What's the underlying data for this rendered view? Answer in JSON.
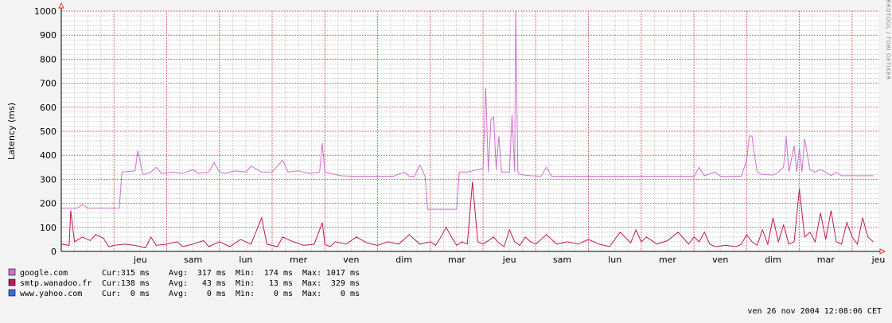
{
  "chart_data": {
    "type": "line",
    "ylabel": "Latency (ms)",
    "ylim": [
      0,
      1000
    ],
    "y_ticks": [
      0,
      100,
      200,
      300,
      400,
      500,
      600,
      700,
      800,
      900,
      1000
    ],
    "x_tick_labels": [
      "jeu",
      "sam",
      "lun",
      "mer",
      "ven",
      "dim",
      "mar",
      "jeu",
      "sam",
      "lun",
      "mer",
      "ven",
      "dim",
      "mar",
      "jeu"
    ],
    "x_units": "days",
    "x_range_days": [
      0,
      15.5
    ],
    "x_tick_days": [
      1,
      2,
      3,
      4,
      5,
      6,
      7,
      8,
      9,
      10,
      11,
      12,
      13,
      14,
      15
    ],
    "side_label": "RRDTOOL / TOBI OETIKER",
    "timestamp": "ven 26 nov 2004 12:08:06 CET",
    "grid": true,
    "colors": {
      "background": "#f3f3f3",
      "canvas": "#ffffff",
      "minor_grid": "#c8c8c8",
      "major_grid": "#d34a4a",
      "axis_arrow": "#e23a3a"
    },
    "series": [
      {
        "name": "google.com",
        "color": "#d070d0",
        "stats": {
          "cur": "315 ms",
          "avg": "317 ms",
          "min": "174 ms",
          "max": "1017 ms"
        },
        "points": [
          [
            0.0,
            180
          ],
          [
            0.3,
            180
          ],
          [
            0.4,
            195
          ],
          [
            0.5,
            180
          ],
          [
            0.8,
            180
          ],
          [
            1.1,
            180
          ],
          [
            1.15,
            330
          ],
          [
            1.4,
            335
          ],
          [
            1.45,
            420
          ],
          [
            1.55,
            320
          ],
          [
            1.7,
            330
          ],
          [
            1.8,
            350
          ],
          [
            1.9,
            325
          ],
          [
            2.1,
            330
          ],
          [
            2.3,
            325
          ],
          [
            2.5,
            340
          ],
          [
            2.6,
            325
          ],
          [
            2.8,
            330
          ],
          [
            2.9,
            370
          ],
          [
            3.0,
            330
          ],
          [
            3.1,
            325
          ],
          [
            3.3,
            335
          ],
          [
            3.5,
            330
          ],
          [
            3.6,
            355
          ],
          [
            3.8,
            330
          ],
          [
            4.0,
            330
          ],
          [
            4.2,
            380
          ],
          [
            4.3,
            330
          ],
          [
            4.5,
            335
          ],
          [
            4.7,
            325
          ],
          [
            4.9,
            330
          ],
          [
            4.95,
            450
          ],
          [
            5.0,
            330
          ],
          [
            5.2,
            320
          ],
          [
            5.3,
            315
          ],
          [
            5.5,
            313
          ],
          [
            5.7,
            313
          ],
          [
            6.0,
            313
          ],
          [
            6.3,
            313
          ],
          [
            6.5,
            330
          ],
          [
            6.6,
            313
          ],
          [
            6.7,
            313
          ],
          [
            6.8,
            360
          ],
          [
            6.9,
            313
          ],
          [
            6.95,
            175
          ],
          [
            7.2,
            175
          ],
          [
            7.5,
            175
          ],
          [
            7.55,
            330
          ],
          [
            7.7,
            330
          ],
          [
            7.9,
            340
          ],
          [
            8.0,
            345
          ],
          [
            8.05,
            680
          ],
          [
            8.1,
            330
          ],
          [
            8.15,
            550
          ],
          [
            8.2,
            560
          ],
          [
            8.25,
            340
          ],
          [
            8.3,
            480
          ],
          [
            8.35,
            330
          ],
          [
            8.5,
            330
          ],
          [
            8.55,
            570
          ],
          [
            8.6,
            330
          ],
          [
            8.62,
            1000
          ],
          [
            8.66,
            330
          ],
          [
            8.7,
            320
          ],
          [
            8.9,
            315
          ],
          [
            9.1,
            313
          ],
          [
            9.2,
            350
          ],
          [
            9.3,
            313
          ],
          [
            9.5,
            313
          ],
          [
            9.8,
            313
          ],
          [
            10.0,
            313
          ],
          [
            10.5,
            313
          ],
          [
            11.0,
            313
          ],
          [
            11.2,
            313
          ],
          [
            11.5,
            313
          ],
          [
            11.8,
            313
          ],
          [
            12.0,
            313
          ],
          [
            12.1,
            350
          ],
          [
            12.2,
            315
          ],
          [
            12.4,
            330
          ],
          [
            12.5,
            313
          ],
          [
            12.7,
            313
          ],
          [
            12.9,
            313
          ],
          [
            13.0,
            380
          ],
          [
            13.05,
            480
          ],
          [
            13.1,
            480
          ],
          [
            13.15,
            400
          ],
          [
            13.2,
            330
          ],
          [
            13.3,
            320
          ],
          [
            13.5,
            318
          ],
          [
            13.6,
            330
          ],
          [
            13.7,
            350
          ],
          [
            13.75,
            480
          ],
          [
            13.8,
            330
          ],
          [
            13.9,
            440
          ],
          [
            13.95,
            330
          ],
          [
            14.0,
            430
          ],
          [
            14.05,
            330
          ],
          [
            14.1,
            470
          ],
          [
            14.2,
            340
          ],
          [
            14.3,
            330
          ],
          [
            14.4,
            340
          ],
          [
            14.5,
            330
          ],
          [
            14.6,
            315
          ],
          [
            14.7,
            330
          ],
          [
            14.8,
            315
          ],
          [
            15.0,
            315
          ],
          [
            15.4,
            315
          ]
        ]
      },
      {
        "name": "smtp.wanadoo.fr",
        "color": "#c0185a",
        "stats": {
          "cur": "138 ms",
          "avg": "43 ms",
          "min": "13 ms",
          "max": "329 ms"
        },
        "points": [
          [
            0.0,
            30
          ],
          [
            0.15,
            25
          ],
          [
            0.18,
            170
          ],
          [
            0.25,
            40
          ],
          [
            0.4,
            60
          ],
          [
            0.55,
            45
          ],
          [
            0.65,
            70
          ],
          [
            0.8,
            55
          ],
          [
            0.9,
            20
          ],
          [
            1.0,
            25
          ],
          [
            1.2,
            30
          ],
          [
            1.4,
            25
          ],
          [
            1.6,
            15
          ],
          [
            1.7,
            60
          ],
          [
            1.8,
            25
          ],
          [
            2.0,
            30
          ],
          [
            2.2,
            40
          ],
          [
            2.3,
            20
          ],
          [
            2.5,
            30
          ],
          [
            2.7,
            45
          ],
          [
            2.8,
            20
          ],
          [
            3.0,
            40
          ],
          [
            3.2,
            20
          ],
          [
            3.4,
            50
          ],
          [
            3.6,
            30
          ],
          [
            3.8,
            140
          ],
          [
            3.9,
            30
          ],
          [
            4.1,
            20
          ],
          [
            4.2,
            60
          ],
          [
            4.4,
            40
          ],
          [
            4.6,
            25
          ],
          [
            4.8,
            30
          ],
          [
            4.95,
            120
          ],
          [
            5.0,
            30
          ],
          [
            5.1,
            20
          ],
          [
            5.2,
            40
          ],
          [
            5.4,
            30
          ],
          [
            5.6,
            60
          ],
          [
            5.8,
            35
          ],
          [
            6.0,
            25
          ],
          [
            6.2,
            40
          ],
          [
            6.4,
            30
          ],
          [
            6.6,
            70
          ],
          [
            6.8,
            30
          ],
          [
            7.0,
            40
          ],
          [
            7.1,
            25
          ],
          [
            7.2,
            60
          ],
          [
            7.3,
            100
          ],
          [
            7.4,
            60
          ],
          [
            7.5,
            25
          ],
          [
            7.6,
            40
          ],
          [
            7.7,
            30
          ],
          [
            7.8,
            290
          ],
          [
            7.9,
            40
          ],
          [
            8.0,
            30
          ],
          [
            8.2,
            60
          ],
          [
            8.3,
            35
          ],
          [
            8.4,
            20
          ],
          [
            8.5,
            90
          ],
          [
            8.6,
            40
          ],
          [
            8.7,
            25
          ],
          [
            8.8,
            60
          ],
          [
            8.9,
            40
          ],
          [
            9.0,
            30
          ],
          [
            9.2,
            70
          ],
          [
            9.4,
            30
          ],
          [
            9.6,
            40
          ],
          [
            9.8,
            30
          ],
          [
            10.0,
            50
          ],
          [
            10.2,
            30
          ],
          [
            10.4,
            20
          ],
          [
            10.6,
            80
          ],
          [
            10.8,
            35
          ],
          [
            10.9,
            90
          ],
          [
            11.0,
            40
          ],
          [
            11.1,
            60
          ],
          [
            11.3,
            30
          ],
          [
            11.5,
            45
          ],
          [
            11.7,
            80
          ],
          [
            11.9,
            30
          ],
          [
            12.0,
            60
          ],
          [
            12.1,
            40
          ],
          [
            12.2,
            80
          ],
          [
            12.3,
            30
          ],
          [
            12.4,
            20
          ],
          [
            12.6,
            25
          ],
          [
            12.8,
            20
          ],
          [
            12.9,
            30
          ],
          [
            13.0,
            70
          ],
          [
            13.1,
            40
          ],
          [
            13.2,
            25
          ],
          [
            13.3,
            90
          ],
          [
            13.4,
            30
          ],
          [
            13.5,
            140
          ],
          [
            13.6,
            40
          ],
          [
            13.7,
            110
          ],
          [
            13.8,
            30
          ],
          [
            13.9,
            40
          ],
          [
            14.0,
            260
          ],
          [
            14.1,
            60
          ],
          [
            14.2,
            80
          ],
          [
            14.3,
            40
          ],
          [
            14.4,
            160
          ],
          [
            14.5,
            50
          ],
          [
            14.6,
            170
          ],
          [
            14.7,
            40
          ],
          [
            14.8,
            30
          ],
          [
            14.9,
            120
          ],
          [
            15.0,
            60
          ],
          [
            15.1,
            30
          ],
          [
            15.2,
            140
          ],
          [
            15.3,
            60
          ],
          [
            15.4,
            40
          ]
        ]
      },
      {
        "name": "www.yahoo.com",
        "color": "#3a6ae0",
        "stats": {
          "cur": "0 ms",
          "avg": "0 ms",
          "min": "0 ms",
          "max": "0 ms"
        },
        "points": []
      }
    ],
    "stat_labels": {
      "cur": "Cur:",
      "avg": "Avg:",
      "min": "Min:",
      "max": "Max:"
    }
  }
}
